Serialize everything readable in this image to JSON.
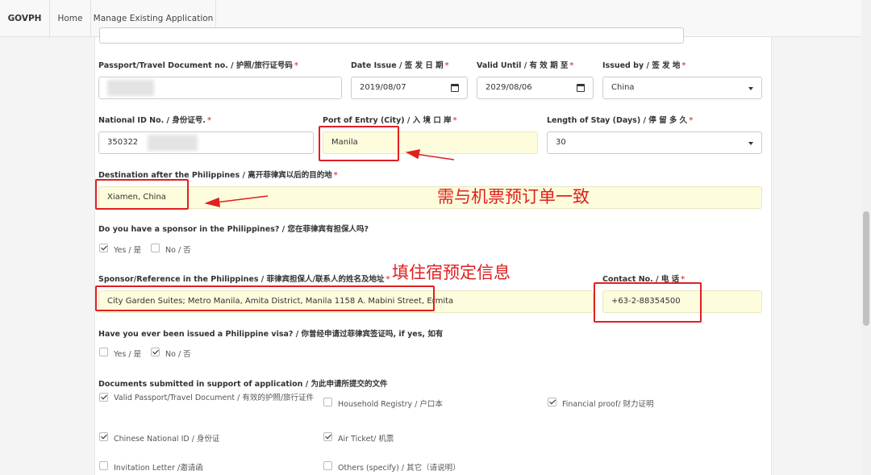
{
  "nav": {
    "brand": "GOVPH",
    "home": "Home",
    "manage": "Manage Existing Application"
  },
  "form": {
    "passport": {
      "label": "Passport/Travel Document no. / 护照/旅行证号码",
      "value": ""
    },
    "date_issue": {
      "label": "Date Issue / 签 发 日 期",
      "value": "2019/08/07"
    },
    "valid_until": {
      "label": "Valid Until / 有 效 期 至",
      "value": "2029/08/06"
    },
    "issued_by": {
      "label": "Issued by / 签 发 地",
      "value": "China"
    },
    "national_id": {
      "label": "National ID No. / 身份证号.",
      "value": "350322"
    },
    "port_of_entry": {
      "label": "Port of Entry (City) / 入 境 口 岸",
      "value": "Manila"
    },
    "length_of_stay": {
      "label": "Length of Stay (Days) / 停 留 多 久",
      "value": "30"
    },
    "destination": {
      "label": "Destination after the Philippines / 离开菲律宾以后的目的地",
      "value": "Xiamen, China"
    },
    "sponsor_q": {
      "label": "Do you have a sponsor in the Philippines? / 您在菲律宾有担保人吗?",
      "yes": "Yes / 是",
      "no": "No / 否",
      "yes_checked": true,
      "no_checked": false
    },
    "sponsor_ref": {
      "label": "Sponsor/Reference in the Philippines / 菲律宾担保人/联系人的姓名及地址",
      "value": "City Garden Suites; Metro Manila, Amita District, Manila 1158 A. Mabini Street, Ermita"
    },
    "contact": {
      "label": "Contact No. / 电 话",
      "value": "+63-2-88354500"
    },
    "visa_q": {
      "label": "Have you ever been issued a Philippine visa? / 你曾经申请过菲律宾签证吗, if yes, 如有",
      "yes": "Yes / 是",
      "no": "No / 否",
      "yes_checked": false,
      "no_checked": true
    },
    "documents": {
      "label": "Documents submitted in support of application / 为此申请所提交的文件",
      "items": [
        {
          "label": "Valid Passport/Travel Document / 有效的护照/旅行证件",
          "checked": true
        },
        {
          "label": "Household Registry / 户口本",
          "checked": false
        },
        {
          "label": "Financial proof/ 财力证明",
          "checked": true
        },
        {
          "label": "Chinese National ID / 身份证",
          "checked": true
        },
        {
          "label": "Air Ticket/ 机票",
          "checked": true
        },
        {
          "label": "Invitation Letter /邀请函",
          "checked": false
        },
        {
          "label": "Others (specify) / 其它（请说明）",
          "checked": false
        }
      ]
    }
  },
  "annotations": {
    "note_ticket": "需与机票预订单一致",
    "note_hotel": "填住宿预定信息"
  },
  "colors": {
    "highlight": "#fdfcdc",
    "annotation": "#e02020",
    "required": "#d9534f"
  },
  "icons": [
    "calendar-icon",
    "caret-down-icon",
    "check-icon",
    "arrow-left-icon"
  ]
}
